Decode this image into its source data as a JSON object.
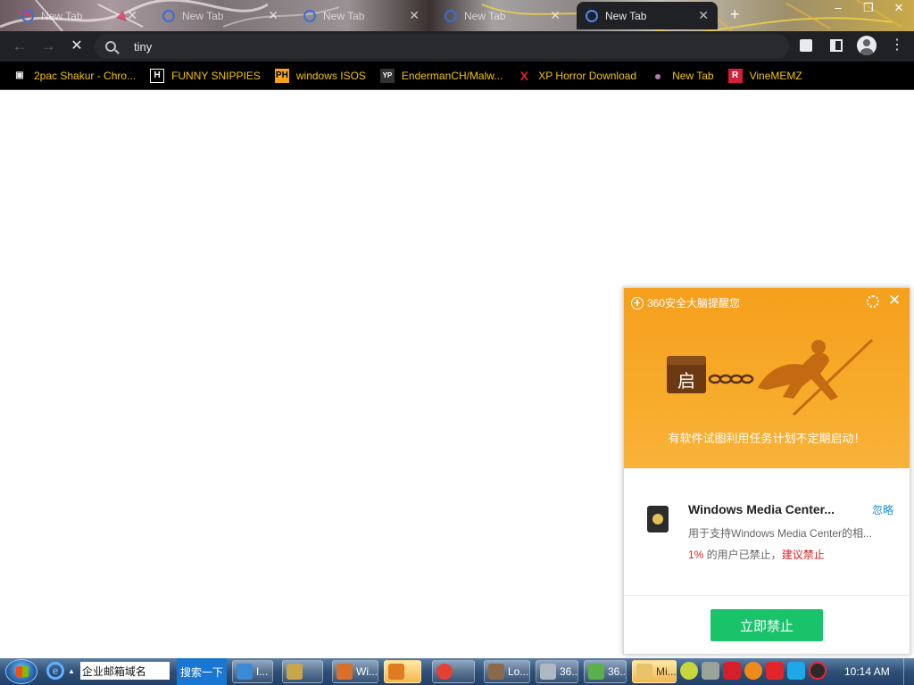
{
  "browser": {
    "tabs": [
      {
        "title": "New Tab",
        "active": false
      },
      {
        "title": "New Tab",
        "active": false
      },
      {
        "title": "New Tab",
        "active": false
      },
      {
        "title": "New Tab",
        "active": false
      },
      {
        "title": "New Tab",
        "active": true
      }
    ],
    "new_tab_glyph": "+",
    "window_controls": {
      "minimize": "–",
      "restore": "❐",
      "close": "✕"
    },
    "nav": {
      "back": "←",
      "forward": "→",
      "stop": "✕"
    },
    "omnibox": {
      "value": "tiny"
    },
    "toolbar_menu": "⋮",
    "bookmarks": [
      {
        "label": "2pac Shakur - Chro...",
        "icon_text": "▣",
        "icon_color": "#e6e6e6"
      },
      {
        "label": "FUNNY SNIPPIES",
        "icon_text": "H",
        "icon_color": "#ffffff"
      },
      {
        "label": "windows ISOS",
        "icon_text": "PH",
        "icon_color": "#f5a31a"
      },
      {
        "label": "EndermanCH/Malw...",
        "icon_text": "YP",
        "icon_color": "#333333"
      },
      {
        "label": "XP Horror Download",
        "icon_text": "X",
        "icon_color": "#e02020"
      },
      {
        "label": "New Tab",
        "icon_text": "●",
        "icon_color": "#b07aa8"
      },
      {
        "label": "VineMEMZ",
        "icon_text": "R",
        "icon_color": "#d0203a"
      }
    ]
  },
  "popup": {
    "title": "360安全大脑提醒您",
    "close_glyph": "✕",
    "hero_box_label": "启",
    "hero_text": "有软件试图利用任务计划不定期启动！",
    "item": {
      "name": "Windows Media Center...",
      "ignore_label": "忽略",
      "description": "用于支持Windows Media Center的相...",
      "stat_pct": "1%",
      "stat_mid": " 的用户已禁止，",
      "stat_advice": "建议禁止"
    },
    "button_label": "立即禁止",
    "colors": {
      "hero": "#f7a521",
      "button": "#18c36a",
      "link": "#1a8cdd"
    }
  },
  "taskbar": {
    "search_value": "企业邮箱域名",
    "ie_glyph": "e",
    "search_button": "搜索一下",
    "buttons": [
      {
        "label": "I...",
        "color": "#3a8ad8",
        "active": false
      },
      {
        "label": "",
        "color": "#c9a64a",
        "active": false
      },
      {
        "label": "Wi...",
        "color": "#d86f2a",
        "active": false
      },
      {
        "label": "",
        "color": "#e07b1f",
        "active": true
      },
      {
        "label": "",
        "color": "#e34133",
        "active": false
      },
      {
        "label": "Lo...",
        "color": "#8a6a4a",
        "active": false
      },
      {
        "label": "36...",
        "color": "#b0b8c4",
        "active": false
      },
      {
        "label": "36...",
        "color": "#5ab04a",
        "active": false
      },
      {
        "label": "Mi...",
        "color": "#e8c26a",
        "active": true
      }
    ],
    "clock": "10:14 AM"
  }
}
